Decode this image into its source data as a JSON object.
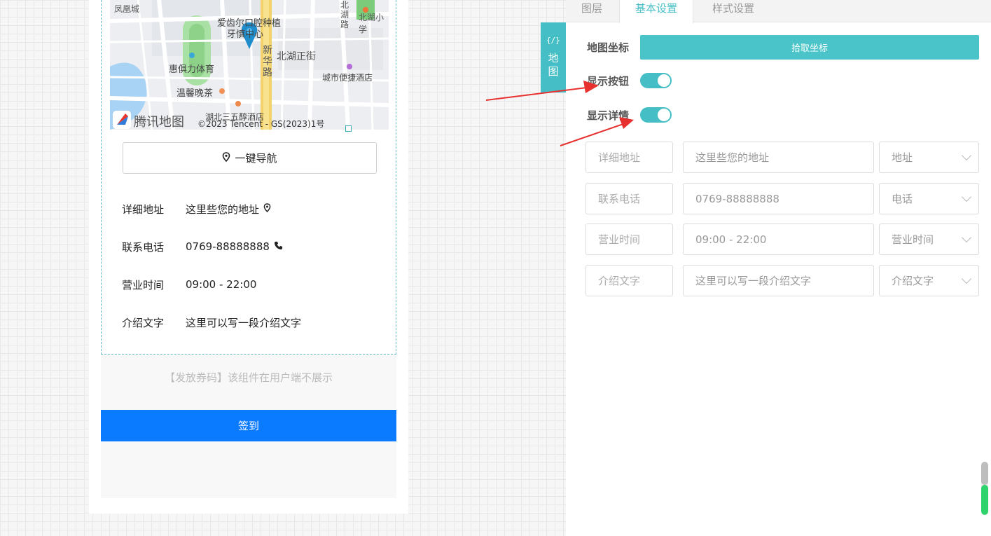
{
  "map": {
    "labels": {
      "fenghuangcheng": "凤凰城",
      "clinic_line1": "爱齿尔口腔种植",
      "clinic_line2": "牙慎中心",
      "beihu_road": "北湖路",
      "beihu_xiao": "北湖小学",
      "huijuli": "惠俱力体育",
      "xinhua_road": "新华路",
      "beihu_zhengjie": "北湖正街",
      "chengshi_hotel": "城市便捷酒店",
      "wenxin_tea": "温馨晚茶",
      "hubei_hotel": "湖北三五醇酒店"
    },
    "logo_text": "腾讯地图",
    "copyright": "©2023 Tencent - GS(2023)1号"
  },
  "preview": {
    "nav_button_label": "一键导航",
    "rows": [
      {
        "key": "详细地址",
        "value": "这里些您的地址",
        "icon": "location-pin-icon"
      },
      {
        "key": "联系电话",
        "value": "0769-88888888",
        "icon": "phone-icon"
      },
      {
        "key": "营业时间",
        "value": "09:00 - 22:00"
      },
      {
        "key": "介绍文字",
        "value": "这里可以写一段介绍文字"
      }
    ],
    "coupon_hint": "【发放券码】该组件在用户端不展示",
    "signin_label": "签到"
  },
  "panel": {
    "tabs": [
      "图层",
      "基本设置",
      "样式设置"
    ],
    "active_tab": "基本设置",
    "side_tag": {
      "code": "{/}",
      "line1": "地",
      "line2": "图"
    },
    "map_coord_label": "地图坐标",
    "pick_coord_button": "拾取坐标",
    "show_button_label": "显示按钮",
    "show_button_on": true,
    "show_detail_label": "显示详情",
    "show_detail_on": true,
    "fields": [
      {
        "label": "详细地址",
        "value": "这里些您的地址",
        "select": "地址"
      },
      {
        "label": "联系电话",
        "value": "0769-88888888",
        "select": "电话"
      },
      {
        "label": "营业时间",
        "value": "09:00 - 22:00",
        "select": "营业时间"
      },
      {
        "label": "介绍文字",
        "value": "这里可以写一段介绍文字",
        "select": "介绍文字"
      }
    ]
  },
  "colors": {
    "accent": "#45bec6",
    "primary_blue": "#0a7bff",
    "annotation_red": "#e8312f",
    "scroll_green": "#2fd36b"
  }
}
